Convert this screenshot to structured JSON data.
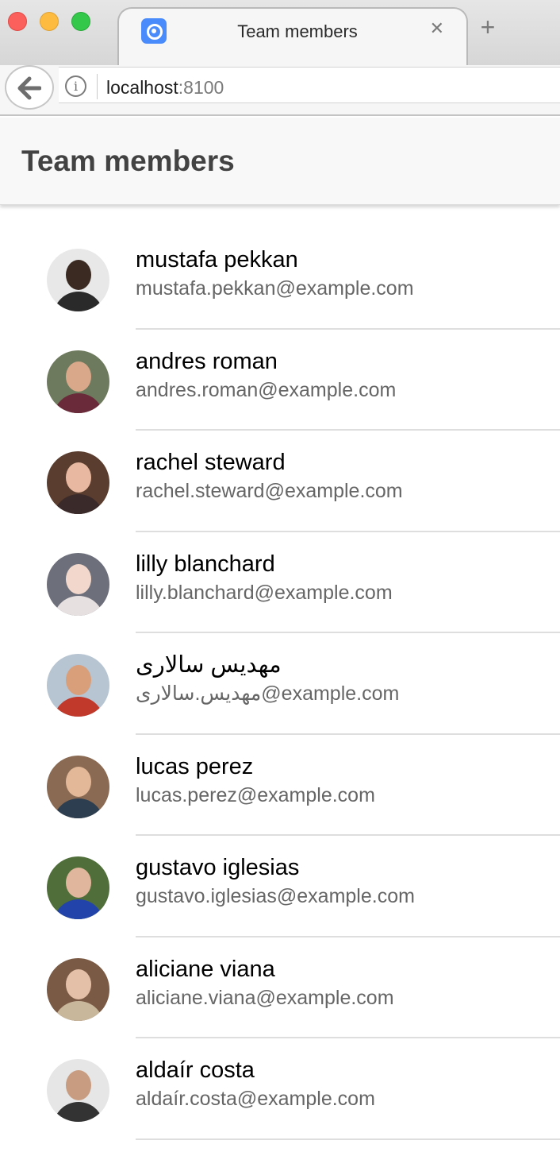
{
  "browser": {
    "tab_title": "Team members",
    "url_host": "localhost",
    "url_port": ":8100"
  },
  "header": {
    "title": "Team members"
  },
  "members": [
    {
      "name": "mustafa pekkan",
      "email": "mustafa.pekkan@example.com",
      "bg": "#e8e8e8",
      "skin": "#3a2a22",
      "shirt": "#2a2a2a"
    },
    {
      "name": "andres roman",
      "email": "andres.roman@example.com",
      "bg": "#6e7a5e",
      "skin": "#d9a88a",
      "shirt": "#6a2a3a"
    },
    {
      "name": "rachel steward",
      "email": "rachel.steward@example.com",
      "bg": "#5a3d2e",
      "skin": "#e8b9a0",
      "shirt": "#3a2a2a"
    },
    {
      "name": "lilly blanchard",
      "email": "lilly.blanchard@example.com",
      "bg": "#6d6f7a",
      "skin": "#f2d8cc",
      "shirt": "#e6e0e0"
    },
    {
      "name": "مهدیس سالاری",
      "email": "مهدیس.سالاری@example.com",
      "bg": "#b7c4d2",
      "skin": "#d99e7a",
      "shirt": "#c0392b"
    },
    {
      "name": "lucas perez",
      "email": "lucas.perez@example.com",
      "bg": "#8a6a52",
      "skin": "#e2b899",
      "shirt": "#2c3e50"
    },
    {
      "name": "gustavo iglesias",
      "email": "gustavo.iglesias@example.com",
      "bg": "#4f6e3a",
      "skin": "#e0b79c",
      "shirt": "#2244aa"
    },
    {
      "name": "aliciane viana",
      "email": "aliciane.viana@example.com",
      "bg": "#7a5a44",
      "skin": "#e4c0a8",
      "shirt": "#c9b79c"
    },
    {
      "name": "aldaír costa",
      "email": "aldaír.costa@example.com",
      "bg": "#e6e6e6",
      "skin": "#c79c80",
      "shirt": "#333333"
    }
  ]
}
